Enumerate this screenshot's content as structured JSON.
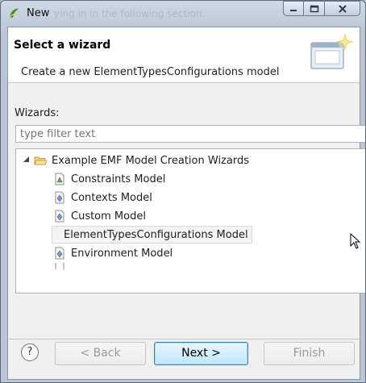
{
  "window": {
    "title": "New",
    "background_ghost_text": "ying in in the following section."
  },
  "header": {
    "title": "Select a wizard",
    "description": "Create a new ElementTypesConfigurations model"
  },
  "wizards_label": "Wizards:",
  "filter": {
    "placeholder": "type filter text",
    "value": ""
  },
  "tree": {
    "category": {
      "label": "Example EMF Model Creation Wizards",
      "expanded": true
    },
    "items": [
      {
        "label": "Constraints Model"
      },
      {
        "label": "Contexts Model"
      },
      {
        "label": "Custom Model"
      },
      {
        "label": "ElementTypesConfigurations Model",
        "selected": true
      },
      {
        "label": "Environment Model"
      }
    ]
  },
  "buttons": {
    "help_glyph": "?",
    "back": "< Back",
    "next": "Next >",
    "finish": "Finish"
  },
  "colors": {
    "primary_button": "#bee6fd",
    "folder": "#e8b84a"
  }
}
